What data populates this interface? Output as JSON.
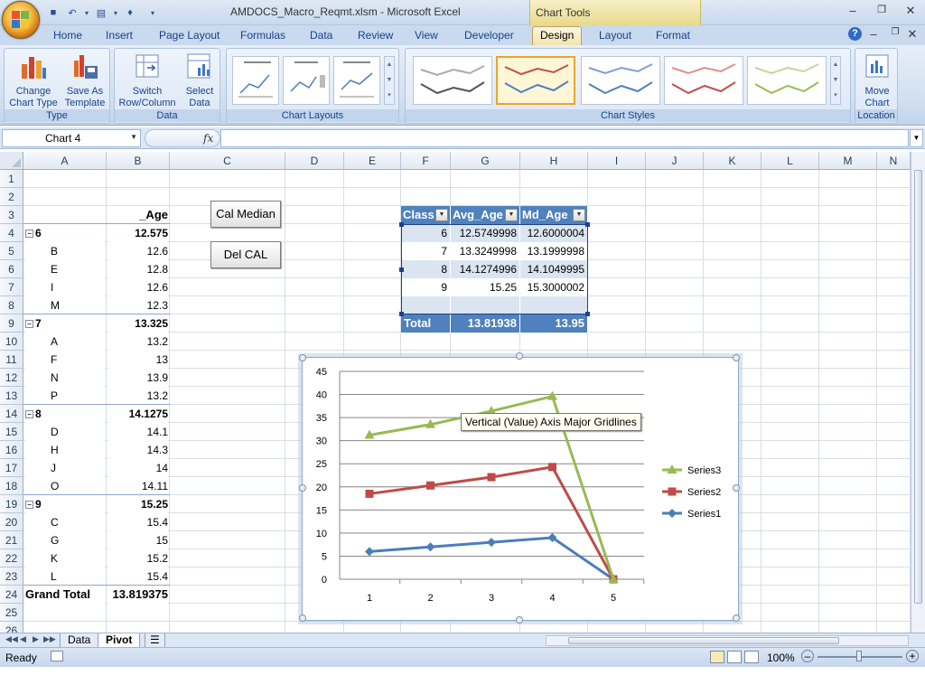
{
  "window": {
    "title": "AMDOCS_Macro_Reqmt.xlsm - Microsoft Excel",
    "context_tab": "Chart Tools"
  },
  "ribbon": {
    "tabs": [
      "Home",
      "Insert",
      "Page Layout",
      "Formulas",
      "Data",
      "Review",
      "View",
      "Developer",
      "Design",
      "Layout",
      "Format"
    ],
    "active_tab": "Design",
    "groups": {
      "type": {
        "label": "Type",
        "change_chart_type_l1": "Change",
        "change_chart_type_l2": "Chart Type",
        "save_template_l1": "Save As",
        "save_template_l2": "Template"
      },
      "data": {
        "label": "Data",
        "switch_l1": "Switch",
        "switch_l2": "Row/Column",
        "select_l1": "Select",
        "select_l2": "Data"
      },
      "layouts": {
        "label": "Chart Layouts"
      },
      "styles": {
        "label": "Chart Styles"
      },
      "location": {
        "label": "Location",
        "move_l1": "Move",
        "move_l2": "Chart"
      }
    }
  },
  "formula_bar": {
    "name_box": "Chart 4",
    "fx": "fx",
    "formula": ""
  },
  "columns": [
    "A",
    "B",
    "C",
    "D",
    "E",
    "F",
    "G",
    "H",
    "I",
    "J",
    "K",
    "L",
    "M",
    "N"
  ],
  "rows": [
    "1",
    "2",
    "3",
    "4",
    "5",
    "6",
    "7",
    "8",
    "9",
    "10",
    "11",
    "12",
    "13",
    "14",
    "15",
    "16",
    "17",
    "18",
    "19",
    "20",
    "21",
    "22",
    "23",
    "24",
    "25",
    "26"
  ],
  "pivot": {
    "header_b": "_Age",
    "grand_total_label": "Grand Total",
    "grand_total_value": "13.819375",
    "groups": [
      {
        "name": "6",
        "value": "12.575",
        "items": [
          {
            "k": "B",
            "v": "12.6"
          },
          {
            "k": "E",
            "v": "12.8"
          },
          {
            "k": "I",
            "v": "12.6"
          },
          {
            "k": "M",
            "v": "12.3"
          }
        ]
      },
      {
        "name": "7",
        "value": "13.325",
        "items": [
          {
            "k": "A",
            "v": "13.2"
          },
          {
            "k": "F",
            "v": "13"
          },
          {
            "k": "N",
            "v": "13.9"
          },
          {
            "k": "P",
            "v": "13.2"
          }
        ]
      },
      {
        "name": "8",
        "value": "14.1275",
        "items": [
          {
            "k": "D",
            "v": "14.1"
          },
          {
            "k": "H",
            "v": "14.3"
          },
          {
            "k": "J",
            "v": "14"
          },
          {
            "k": "O",
            "v": "14.11"
          }
        ]
      },
      {
        "name": "9",
        "value": "15.25",
        "items": [
          {
            "k": "C",
            "v": "15.4"
          },
          {
            "k": "G",
            "v": "15"
          },
          {
            "k": "K",
            "v": "15.2"
          },
          {
            "k": "L",
            "v": "15.4"
          }
        ]
      }
    ]
  },
  "buttons": {
    "cal_median": "Cal Median",
    "del_cal": "Del CAL"
  },
  "table": {
    "headers": [
      "Class",
      "Avg_Age",
      "Md_Age"
    ],
    "rows": [
      [
        "6",
        "12.5749998",
        "12.6000004"
      ],
      [
        "7",
        "13.3249998",
        "13.1999998"
      ],
      [
        "8",
        "14.1274996",
        "14.1049995"
      ],
      [
        "9",
        "15.25",
        "15.3000002"
      ]
    ],
    "total": [
      "Total",
      "13.81938",
      "13.95"
    ]
  },
  "chart_data": {
    "type": "line",
    "x": [
      1,
      2,
      3,
      4,
      5
    ],
    "ylim": [
      0,
      45
    ],
    "yticks": [
      0,
      5,
      10,
      15,
      20,
      25,
      30,
      35,
      40,
      45
    ],
    "grid": true,
    "legend": "right",
    "series": [
      {
        "name": "Series1",
        "values": [
          6,
          7,
          8,
          9,
          0
        ],
        "color": "#4a7ebb",
        "marker": "diamond"
      },
      {
        "name": "Series2",
        "values": [
          18.5,
          20.3,
          22.1,
          24.3,
          0
        ],
        "color": "#be4b48",
        "marker": "square"
      },
      {
        "name": "Series3",
        "values": [
          31.2,
          33.5,
          36.4,
          39.6,
          0
        ],
        "color": "#98b954",
        "marker": "triangle"
      }
    ],
    "tooltip": "Vertical (Value) Axis Major Gridlines"
  },
  "sheets": [
    "Data",
    "Pivot"
  ],
  "active_sheet": "Pivot",
  "status": {
    "ready": "Ready",
    "zoom": "100%"
  },
  "colors": {
    "table_header": "#4f81bd",
    "table_band": "#dbe5f1",
    "ribbon_bg": "#dce7f5"
  }
}
